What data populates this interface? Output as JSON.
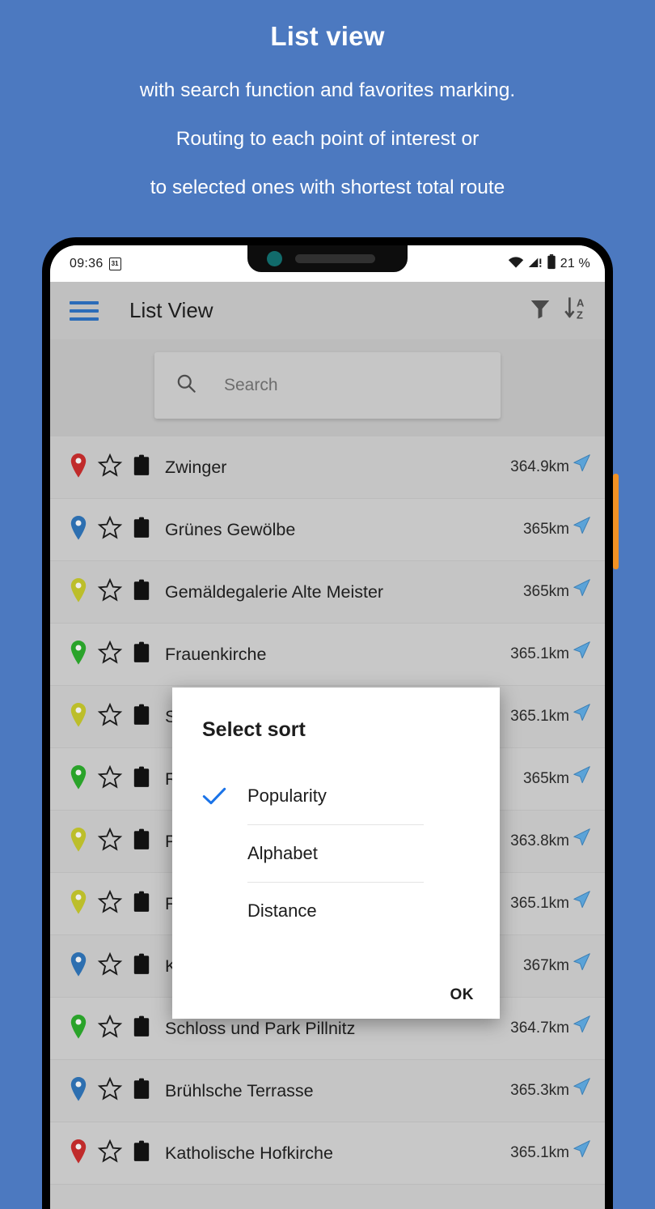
{
  "promo": {
    "title": "List view",
    "lines": [
      "with search function and favorites marking.",
      "Routing to each point of interest or",
      "to selected ones with shortest total route"
    ],
    "background_color": "#4c79c0",
    "text_color": "#ffffff"
  },
  "status_bar": {
    "clock": "09:36",
    "calendar_badge": "31",
    "battery_percent": "21 %",
    "icons": [
      "wifi-icon",
      "cellular-signal-icon",
      "battery-icon"
    ]
  },
  "app_bar": {
    "menu_icon": "hamburger-menu-icon",
    "title": "List View",
    "actions": [
      {
        "icon": "filter-icon",
        "name": "filter-button"
      },
      {
        "icon": "sort-az-icon",
        "name": "sort-button"
      }
    ],
    "accent_color": "#2b6cb8",
    "background_color": "#c0c0c0"
  },
  "search": {
    "placeholder": "Search",
    "value": "",
    "icon": "search-icon"
  },
  "list": {
    "items": [
      {
        "name": "Zwinger",
        "distance": "364.9km",
        "pin_color": "#c02b2b",
        "alt": false
      },
      {
        "name": "Grünes Gewölbe",
        "distance": "365km",
        "pin_color": "#2d6fb0",
        "alt": true
      },
      {
        "name": "Gemäldegalerie Alte Meister",
        "distance": "365km",
        "pin_color": "#bcbe2a",
        "alt": false
      },
      {
        "name": "Frauenkirche",
        "distance": "365.1km",
        "pin_color": "#2aa32a",
        "alt": true
      },
      {
        "name": "S",
        "distance": "365.1km",
        "pin_color": "#bcbe2a",
        "alt": false
      },
      {
        "name": "R",
        "distance": "365km",
        "pin_color": "#2aa32a",
        "alt": true
      },
      {
        "name": "P",
        "distance": "363.8km",
        "pin_color": "#bcbe2a",
        "alt": false
      },
      {
        "name": "F",
        "distance": "365.1km",
        "pin_color": "#bcbe2a",
        "alt": true
      },
      {
        "name": "K",
        "distance": "367km",
        "pin_color": "#2d6fb0",
        "alt": false
      },
      {
        "name": "Schloss und Park Pillnitz",
        "distance": "364.7km",
        "pin_color": "#2aa32a",
        "alt": true
      },
      {
        "name": "Brühlsche Terrasse",
        "distance": "365.3km",
        "pin_color": "#2d6fb0",
        "alt": false
      },
      {
        "name": "Katholische Hofkirche",
        "distance": "365.1km",
        "pin_color": "#c02b2b",
        "alt": true
      }
    ],
    "row_icons": [
      "map-pin-icon",
      "star-outline-icon",
      "clipboard-icon",
      "navigation-arrow-icon"
    ],
    "navigation_arrow_color": "#5ba3d8"
  },
  "dialog": {
    "title": "Select sort",
    "options": [
      {
        "label": "Popularity",
        "selected": true
      },
      {
        "label": "Alphabet",
        "selected": false
      },
      {
        "label": "Distance",
        "selected": false
      }
    ],
    "ok_label": "OK",
    "check_color": "#1a73e8"
  },
  "phone": {
    "side_button_color": "#f29224",
    "notch_camera_color": "#116b6b"
  }
}
